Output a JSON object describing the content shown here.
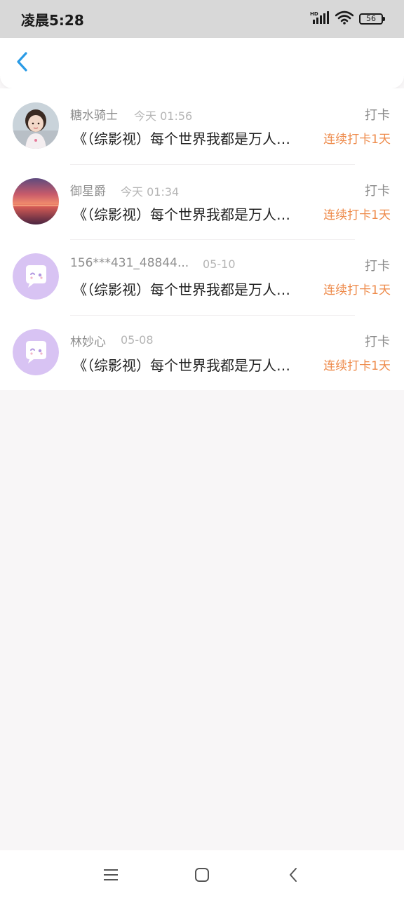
{
  "status_bar": {
    "time": "凌晨5:28",
    "battery": "56",
    "icons": [
      "hd-signal-icon",
      "wifi-icon",
      "battery-icon"
    ]
  },
  "header": {
    "back_icon": "chevron-left-icon",
    "accent_color": "#2a9be6"
  },
  "items": [
    {
      "name": "糖水骑士",
      "date": "今天 01:56",
      "title": "《（综影视）每个世界我都是万人…",
      "type": "打卡",
      "streak": "连续打卡1天",
      "avatar": "photo-avatar-girl"
    },
    {
      "name": "御星爵",
      "date": "今天 01:34",
      "title": "《（综影视）每个世界我都是万人…",
      "type": "打卡",
      "streak": "连续打卡1天",
      "avatar": "photo-avatar-sunset"
    },
    {
      "name": "156***431_48844...",
      "date": "05-10",
      "title": "《（综影视）每个世界我都是万人…",
      "type": "打卡",
      "streak": "连续打卡1天",
      "avatar": "default-avatar-chat-bubble"
    },
    {
      "name": "林妙心",
      "date": "05-08",
      "title": "《（综影视）每个世界我都是万人…",
      "type": "打卡",
      "streak": "连续打卡1天",
      "avatar": "default-avatar-chat-bubble"
    }
  ],
  "colors": {
    "streak": "#ee8a4a",
    "default_avatar_bg": "#d8c3f3",
    "page_bg": "#f8f6f7"
  },
  "nav_bar": {
    "icons": [
      "menu-icon",
      "home-square-icon",
      "back-triangle-icon"
    ]
  }
}
